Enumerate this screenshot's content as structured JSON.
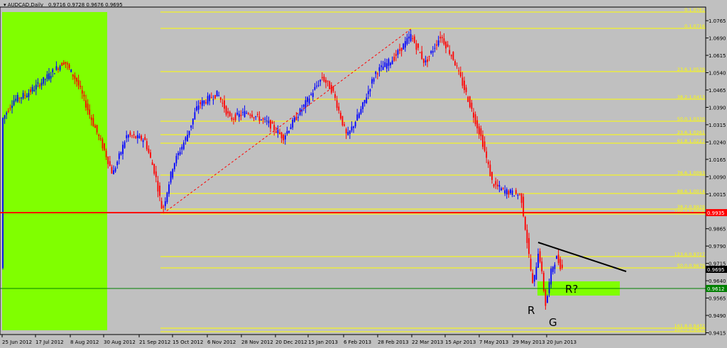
{
  "header": {
    "menu_icon": "dropdown-triangle-icon",
    "symbol": "AUDCAD,Daily",
    "ohlc": "0.9716 0.9728 0.9676 0.9695"
  },
  "x_axis": {
    "dates": [
      "25 Jun 2012",
      "17 Jul 2012",
      "8 Aug 2012",
      "30 Aug 2012",
      "21 Sep 2012",
      "15 Oct 2012",
      "6 Nov 2012",
      "28 Nov 2012",
      "20 Dec 2012",
      "15 Jan 2013",
      "6 Feb 2013",
      "28 Feb 2013",
      "22 Mar 2013",
      "15 Apr 2013",
      "7 May 2013",
      "29 May 2013",
      "20 Jun 2013"
    ]
  },
  "y_axis": {
    "labels": [
      "1.0765",
      "1.0690",
      "1.0615",
      "1.0540",
      "1.0465",
      "1.0390",
      "1.0315",
      "1.0240",
      "1.0165",
      "1.0090",
      "1.0015",
      "0.9940",
      "0.9865",
      "0.9790",
      "0.9715",
      "0.9640",
      "0.9565",
      "0.9490",
      "0.9415"
    ]
  },
  "fib_levels": [
    {
      "label": "0.1.0781"
    },
    {
      "label": "0.1.0716"
    },
    {
      "label": "23.6.1.0529"
    },
    {
      "label": "38.2.1.0413"
    },
    {
      "label": "50.0.1.0320"
    },
    {
      "label": "23.6.1.0261"
    },
    {
      "label": "61.8.1.0227"
    },
    {
      "label": "76.6.1.0093"
    },
    {
      "label": "88.6.1.0014"
    },
    {
      "label": "38.2.0.9929"
    },
    {
      "label": "100.0.0.9906"
    },
    {
      "label": "123.6.0.9727"
    },
    {
      "label": "50.0.0.9679"
    },
    {
      "label": "161.8.0.9432"
    },
    {
      "label": "100.0.0.9420"
    }
  ],
  "price_tags": {
    "red_line": "0.9935",
    "current": "0.9695",
    "green_line": "0.9612"
  },
  "annotations": {
    "left_shoulder": "R",
    "head": "G",
    "right_shoulder": "R?"
  },
  "colors": {
    "background": "#c0c0c0",
    "bull_candle": "#0000ff",
    "bear_candle": "#ff0000",
    "fib_line": "#ffff00",
    "highlight_zone": "#80ff00",
    "resistance_line": "#ff0000",
    "support_line": "#008000",
    "trend_line": "#000000"
  },
  "chart_data": {
    "type": "candlestick",
    "title": "AUDCAD,Daily",
    "ylim": [
      0.9395,
      1.079
    ],
    "categories": [
      "25 Jun 2012",
      "17 Jul 2012",
      "8 Aug 2012",
      "30 Aug 2012",
      "21 Sep 2012",
      "15 Oct 2012",
      "6 Nov 2012",
      "28 Nov 2012",
      "20 Dec 2012",
      "15 Jan 2013",
      "6 Feb 2013",
      "28 Feb 2013",
      "22 Mar 2013",
      "15 Apr 2013",
      "7 May 2013",
      "29 May 2013",
      "20 Jun 2013"
    ],
    "series": [
      {
        "values": [
          1.032,
          1.045,
          1.0585,
          1.018,
          0.9935,
          1.031,
          1.042,
          1.037,
          1.029,
          1.052,
          1.027,
          1.062,
          1.065,
          1.05,
          0.999,
          0.959,
          0.9695
        ]
      }
    ],
    "horizontal_lines": [
      0.9935,
      0.9612
    ]
  }
}
